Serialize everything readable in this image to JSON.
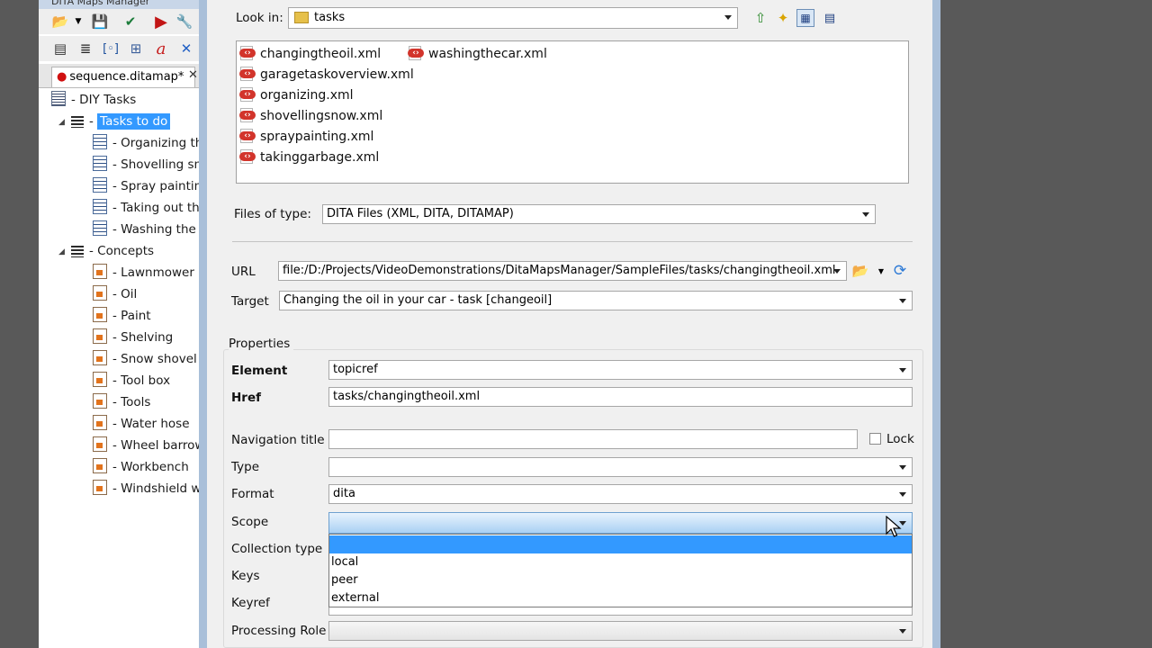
{
  "left_panel": {
    "window_title": "DITA Maps Manager",
    "map_tab": {
      "label": "sequence.ditamap*",
      "close": "✕"
    },
    "tree": {
      "root": "DIY Tasks",
      "tasks_group": "Tasks to do",
      "tasks": [
        "Organizing th",
        "Shovelling sno",
        "Spray paintin",
        "Taking out th",
        "Washing the c"
      ],
      "concepts_group": "Concepts",
      "concepts": [
        "Lawnmower",
        "Oil",
        "Paint",
        "Shelving",
        "Snow shovel",
        "Tool box",
        "Tools",
        "Water hose",
        "Wheel barrow",
        "Workbench",
        "Windshield wa"
      ]
    }
  },
  "dialog": {
    "look_in": {
      "label": "Look in:",
      "value": "tasks"
    },
    "files": [
      "changingtheoil.xml",
      "garagetaskoverview.xml",
      "organizing.xml",
      "shovellingsnow.xml",
      "spraypainting.xml",
      "takinggarbage.xml",
      "washingthecar.xml"
    ],
    "files_of_type": {
      "label": "Files of type:",
      "value": "DITA Files (XML, DITA, DITAMAP)"
    },
    "url": {
      "label": "URL",
      "value": "file:/D:/Projects/VideoDemonstrations/DitaMapsManager/SampleFiles/tasks/changingtheoil.xml"
    },
    "target": {
      "label": "Target",
      "value": "Changing the oil in your car - task [changeoil]"
    },
    "properties": {
      "title": "Properties",
      "element": {
        "label": "Element",
        "value": "topicref"
      },
      "href": {
        "label": "Href",
        "value": "tasks/changingtheoil.xml"
      },
      "navigation_title": {
        "label": "Navigation title",
        "value": ""
      },
      "lock_label": "Lock",
      "type": {
        "label": "Type",
        "value": ""
      },
      "format": {
        "label": "Format",
        "value": "dita"
      },
      "scope": {
        "label": "Scope",
        "value": "",
        "options": [
          "",
          "local",
          "peer",
          "external"
        ]
      },
      "collection_type": {
        "label": "Collection type"
      },
      "keys": {
        "label": "Keys"
      },
      "keyref": {
        "label": "Keyref"
      },
      "processing_role": {
        "label": "Processing Role",
        "value": ""
      }
    }
  },
  "colors": {
    "selection": "#3399ff",
    "dialog_bg": "#f0f0f0",
    "backdrop": "#595959",
    "xml_icon": "#d2342b"
  }
}
